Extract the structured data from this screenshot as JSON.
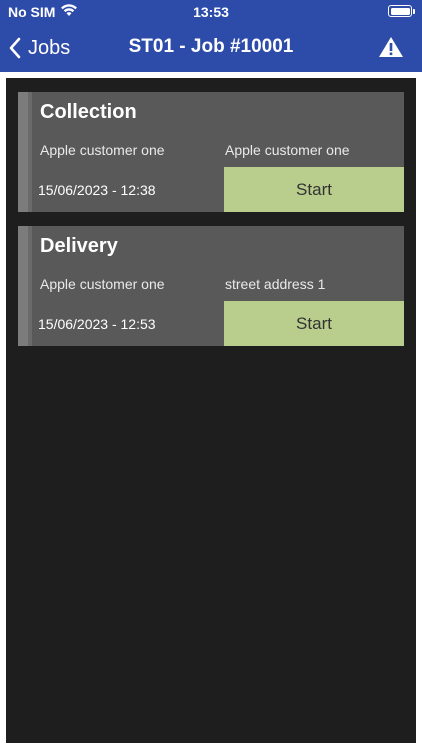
{
  "status_bar": {
    "carrier": "No SIM",
    "time": "13:53"
  },
  "nav": {
    "back_label": "Jobs",
    "title": "ST01 - Job #10001",
    "alert_icon": "warning-triangle-icon"
  },
  "jobs": [
    {
      "title": "Collection",
      "customer": "Apple customer one",
      "location": "Apple customer one",
      "datetime": "15/06/2023 - 12:38",
      "action_label": "Start"
    },
    {
      "title": "Delivery",
      "customer": "Apple customer one",
      "location": "street address 1",
      "datetime": "15/06/2023 - 12:53",
      "action_label": "Start"
    }
  ],
  "colors": {
    "nav_background": "#2d4ba8",
    "content_background": "#1e1e1e",
    "card_background": "#595959",
    "start_button": "#b9cd8c"
  }
}
